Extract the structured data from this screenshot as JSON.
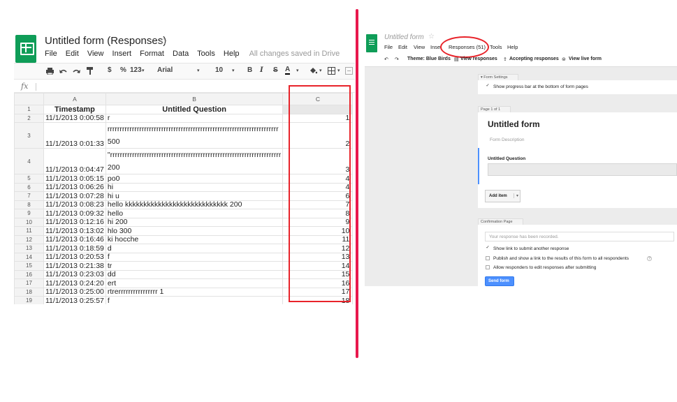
{
  "sheet": {
    "title": "Untitled form (Responses)",
    "star_glyph": "☆",
    "menu": [
      "File",
      "Edit",
      "View",
      "Insert",
      "Format",
      "Data",
      "Tools",
      "Help"
    ],
    "saved_status": "All changes saved in Drive",
    "toolbar": {
      "currency": "$",
      "percent": "%",
      "number_format": "123",
      "font": "Arial",
      "font_size": "10",
      "bold": "B",
      "italic": "I",
      "strike": "S",
      "text_color": "A"
    },
    "fx_label": "fx",
    "columns": [
      "A",
      "B",
      "C"
    ],
    "header_row": {
      "num": "1",
      "a": "Timestamp",
      "b": "Untitled Question",
      "c": ""
    },
    "row2": {
      "num": "2",
      "a": "11/1/2013 0:00:58",
      "b": "r",
      "c": "1"
    },
    "row3": {
      "num": "3",
      "a": "11/1/2013 0:01:33",
      "b_line1": "rrrrrrrrrrrrrrrrrrrrrrrrrrrrrrrrrrrrrrrrrrrrrrrrrrrrrrrrrrrrrrrrrrrrrr",
      "b_line2": "500",
      "c": "2"
    },
    "row4": {
      "num": "4",
      "a": "11/1/2013 0:04:47",
      "b_line1": "\"rrrrrrrrrrrrrrrrrrrrrrrrrrrrrrrrrrrrrrrrrrrrrrrrrrrrrrrrrrrrrrrrrrrrrr",
      "b_line2": "200",
      "c": "3"
    },
    "rows": [
      {
        "num": "5",
        "a": "11/1/2013 0:05:15",
        "b": "po0",
        "c": "4"
      },
      {
        "num": "6",
        "a": "11/1/2013 0:06:26",
        "b": "hi",
        "c": "4"
      },
      {
        "num": "7",
        "a": "11/1/2013 0:07:28",
        "b": "hi u",
        "c": "6"
      },
      {
        "num": "8",
        "a": "11/1/2013 0:08:23",
        "b": "hello kkkkkkkkkkkkkkkkkkkkkkkkkkkk 200",
        "c": "7"
      },
      {
        "num": "9",
        "a": "11/1/2013 0:09:32",
        "b": "hello",
        "c": "8"
      },
      {
        "num": "10",
        "a": "11/1/2013 0:12:16",
        "b": "hi 200",
        "c": "9"
      },
      {
        "num": "11",
        "a": "11/1/2013 0:13:02",
        "b": "hlo 300",
        "c": "10"
      },
      {
        "num": "12",
        "a": "11/1/2013 0:16:46",
        "b": "ki hocche",
        "c": "11"
      },
      {
        "num": "13",
        "a": "11/1/2013 0:18:59",
        "b": "d",
        "c": "12"
      },
      {
        "num": "14",
        "a": "11/1/2013 0:20:53",
        "b": "f",
        "c": "13"
      },
      {
        "num": "15",
        "a": "11/1/2013 0:21:38",
        "b": "tr",
        "c": "14"
      },
      {
        "num": "16",
        "a": "11/1/2013 0:23:03",
        "b": "dd",
        "c": "15"
      },
      {
        "num": "17",
        "a": "11/1/2013 0:24:20",
        "b": "ert",
        "c": "16"
      },
      {
        "num": "18",
        "a": "11/1/2013 0:25:00",
        "b": "rtrerrrrrrrrrrrrrrrr 1",
        "c": "17"
      },
      {
        "num": "19",
        "a": "11/1/2013 0:25:57",
        "b": "f",
        "c": "18"
      }
    ]
  },
  "form": {
    "title": "Untitled form",
    "star_glyph": "☆",
    "menu": {
      "file": "File",
      "edit": "Edit",
      "view": "View",
      "insert": "Inse",
      "responses": "Responses (51)",
      "tools": "Tools",
      "help": "Help"
    },
    "toolbar": {
      "theme": "Theme: Blue Birds",
      "view_responses": "View responses",
      "accepting": "Accepting responses",
      "live": "View live form"
    },
    "settings_tab": "Form Settings",
    "progress_bar_option": "Show progress bar at the bottom of form pages",
    "page_tab": "Page 1 of 1",
    "form_title": "Untitled form",
    "form_description": "Form Description",
    "question_title": "Untitled Question",
    "add_item": "Add item",
    "confirmation_tab": "Confirmation Page",
    "confirmation_message": "Your response has been recorded.",
    "option_submit_another": "Show link to submit another response",
    "option_publish_results": "Publish and show a link to the results of this form to all respondents",
    "option_edit_after": "Allow responders to edit responses after submitting",
    "help_glyph": "?",
    "send_button": "Send form"
  },
  "colors": {
    "sheets_green": "#0f9d58",
    "annotation_red": "#e8232a",
    "divider_pink": "#e8184d",
    "send_blue": "#4d90fe"
  }
}
